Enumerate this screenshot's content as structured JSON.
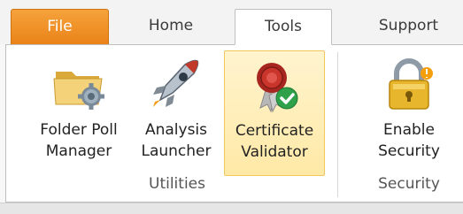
{
  "tabs": [
    {
      "label": "File"
    },
    {
      "label": "Home"
    },
    {
      "label": "Tools"
    },
    {
      "label": "Support"
    }
  ],
  "groups": {
    "utilities": {
      "label": "Utilities",
      "buttons": [
        {
          "line1": "Folder Poll",
          "line2": "Manager",
          "icon": "folder-gear-icon"
        },
        {
          "line1": "Analysis",
          "line2": "Launcher",
          "icon": "rocket-icon"
        },
        {
          "line1": "Certificate",
          "line2": "Validator",
          "icon": "certificate-check-icon"
        }
      ]
    },
    "security": {
      "label": "Security",
      "buttons": [
        {
          "line1": "Enable",
          "line2": "Security",
          "icon": "padlock-icon"
        }
      ]
    }
  },
  "colors": {
    "file_tab": "#e98317",
    "selected_button": "#ffe9a6"
  }
}
